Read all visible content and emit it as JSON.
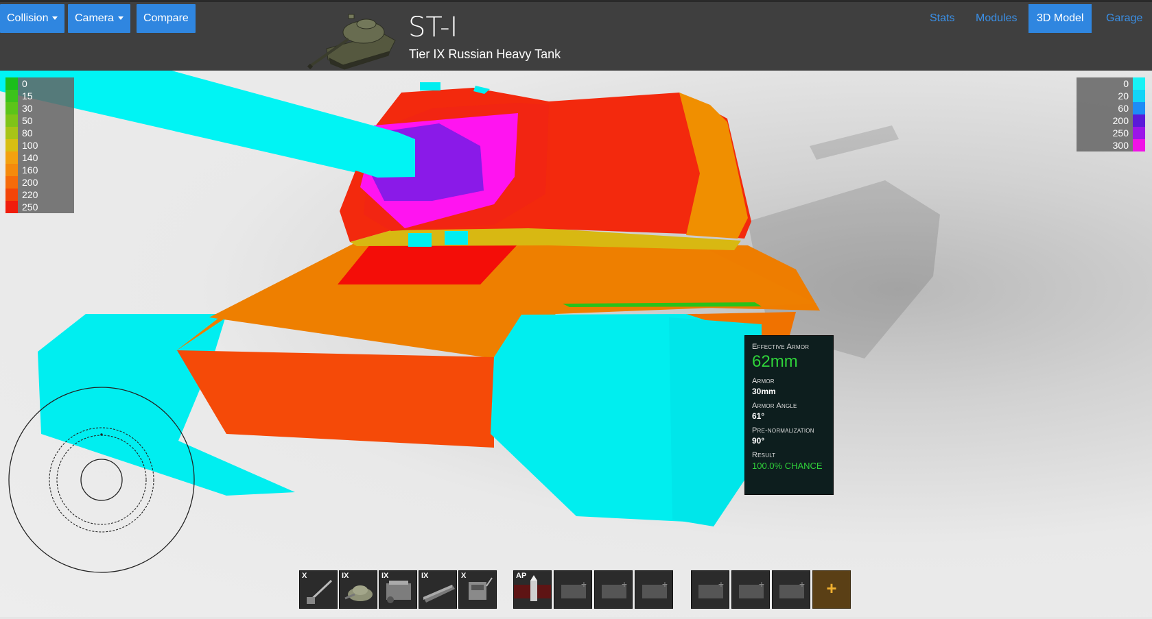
{
  "header": {
    "buttons": [
      {
        "label": "Collision",
        "dropdown": true
      },
      {
        "label": "Camera",
        "dropdown": true
      },
      {
        "label": "Compare",
        "dropdown": false
      }
    ],
    "tank_name": "ST-I",
    "tank_subtitle": "Tier IX Russian Heavy Tank",
    "nav": [
      {
        "label": "Stats",
        "active": false
      },
      {
        "label": "Modules",
        "active": false
      },
      {
        "label": "3D Model",
        "active": true
      },
      {
        "label": "Garage",
        "active": false
      }
    ]
  },
  "legend_left": [
    {
      "label": "0",
      "color": "#1bbf1b"
    },
    {
      "label": "15",
      "color": "#3cc21a"
    },
    {
      "label": "30",
      "color": "#5cc419"
    },
    {
      "label": "50",
      "color": "#7fc418"
    },
    {
      "label": "80",
      "color": "#a8c417"
    },
    {
      "label": "100",
      "color": "#d8be12"
    },
    {
      "label": "140",
      "color": "#f3a10f"
    },
    {
      "label": "160",
      "color": "#f58a0c"
    },
    {
      "label": "200",
      "color": "#f66b0a"
    },
    {
      "label": "220",
      "color": "#f34508"
    },
    {
      "label": "250",
      "color": "#f01d0c"
    }
  ],
  "legend_right": [
    {
      "label": "0",
      "color": "#17f2f5"
    },
    {
      "label": "20",
      "color": "#12d4f7"
    },
    {
      "label": "60",
      "color": "#1e8cf6"
    },
    {
      "label": "200",
      "color": "#5a1ad9"
    },
    {
      "label": "250",
      "color": "#9b16e8"
    },
    {
      "label": "300",
      "color": "#f012e6"
    }
  ],
  "tooltip": {
    "effective_armor_label": "Effective Armor",
    "effective_armor_value": "62mm",
    "armor_label": "Armor",
    "armor_value": "30mm",
    "angle_label": "Armor Angle",
    "angle_value": "61°",
    "prenorm_label": "Pre-normalization",
    "prenorm_value": "90°",
    "result_label": "Result",
    "result_value": "100.0% CHANCE"
  },
  "modules": [
    {
      "tier": "X",
      "icon": "gun-icon"
    },
    {
      "tier": "IX",
      "icon": "turret-icon"
    },
    {
      "tier": "IX",
      "icon": "engine-icon"
    },
    {
      "tier": "IX",
      "icon": "tracks-icon"
    },
    {
      "tier": "X",
      "icon": "radio-icon"
    }
  ],
  "ammo": [
    {
      "tier": "AP",
      "icon": "ap-shell-icon"
    },
    {
      "tier": "",
      "icon": "empty-shell-slot-icon"
    },
    {
      "tier": "",
      "icon": "empty-shell-slot-icon"
    },
    {
      "tier": "",
      "icon": "empty-shell-slot-icon"
    }
  ],
  "equipment": [
    {
      "icon": "empty-equipment-slot-icon"
    },
    {
      "icon": "empty-equipment-slot-icon"
    },
    {
      "icon": "empty-equipment-slot-icon"
    }
  ],
  "add_label": "+"
}
